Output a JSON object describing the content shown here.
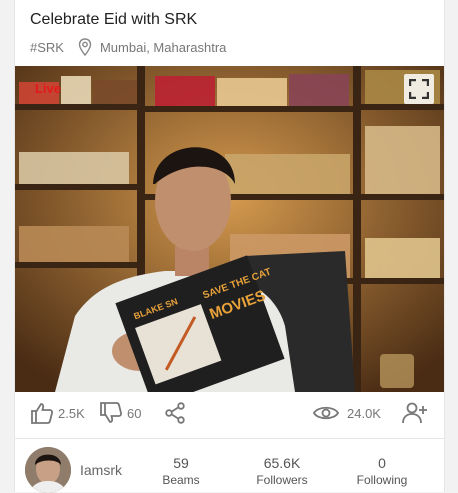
{
  "post": {
    "title": "Celebrate Eid with SRK",
    "hashtag": "#SRK",
    "location": "Mumbai, Maharashtra"
  },
  "video": {
    "live_label": "Live",
    "book_cover_lines": [
      "SAVE THE CAT",
      "MOVIES",
      "BLAKE SN"
    ]
  },
  "actions": {
    "likes": "2.5K",
    "dislikes": "60",
    "views": "24.0K"
  },
  "profile": {
    "username": "Iamsrk",
    "beams_count": "59",
    "beams_label": "Beams",
    "followers_count": "65.6K",
    "followers_label": "Followers",
    "following_count": "0",
    "following_label": "Following"
  },
  "colors": {
    "live": "#e01b1b",
    "icon_gray": "#777777",
    "shelf_wood": "#3a2414",
    "warm_light": "#c98a3e"
  },
  "icons": [
    "location-pin-icon",
    "fullscreen-icon",
    "thumbs-up-icon",
    "thumbs-down-icon",
    "share-icon",
    "eye-icon",
    "add-user-icon"
  ]
}
